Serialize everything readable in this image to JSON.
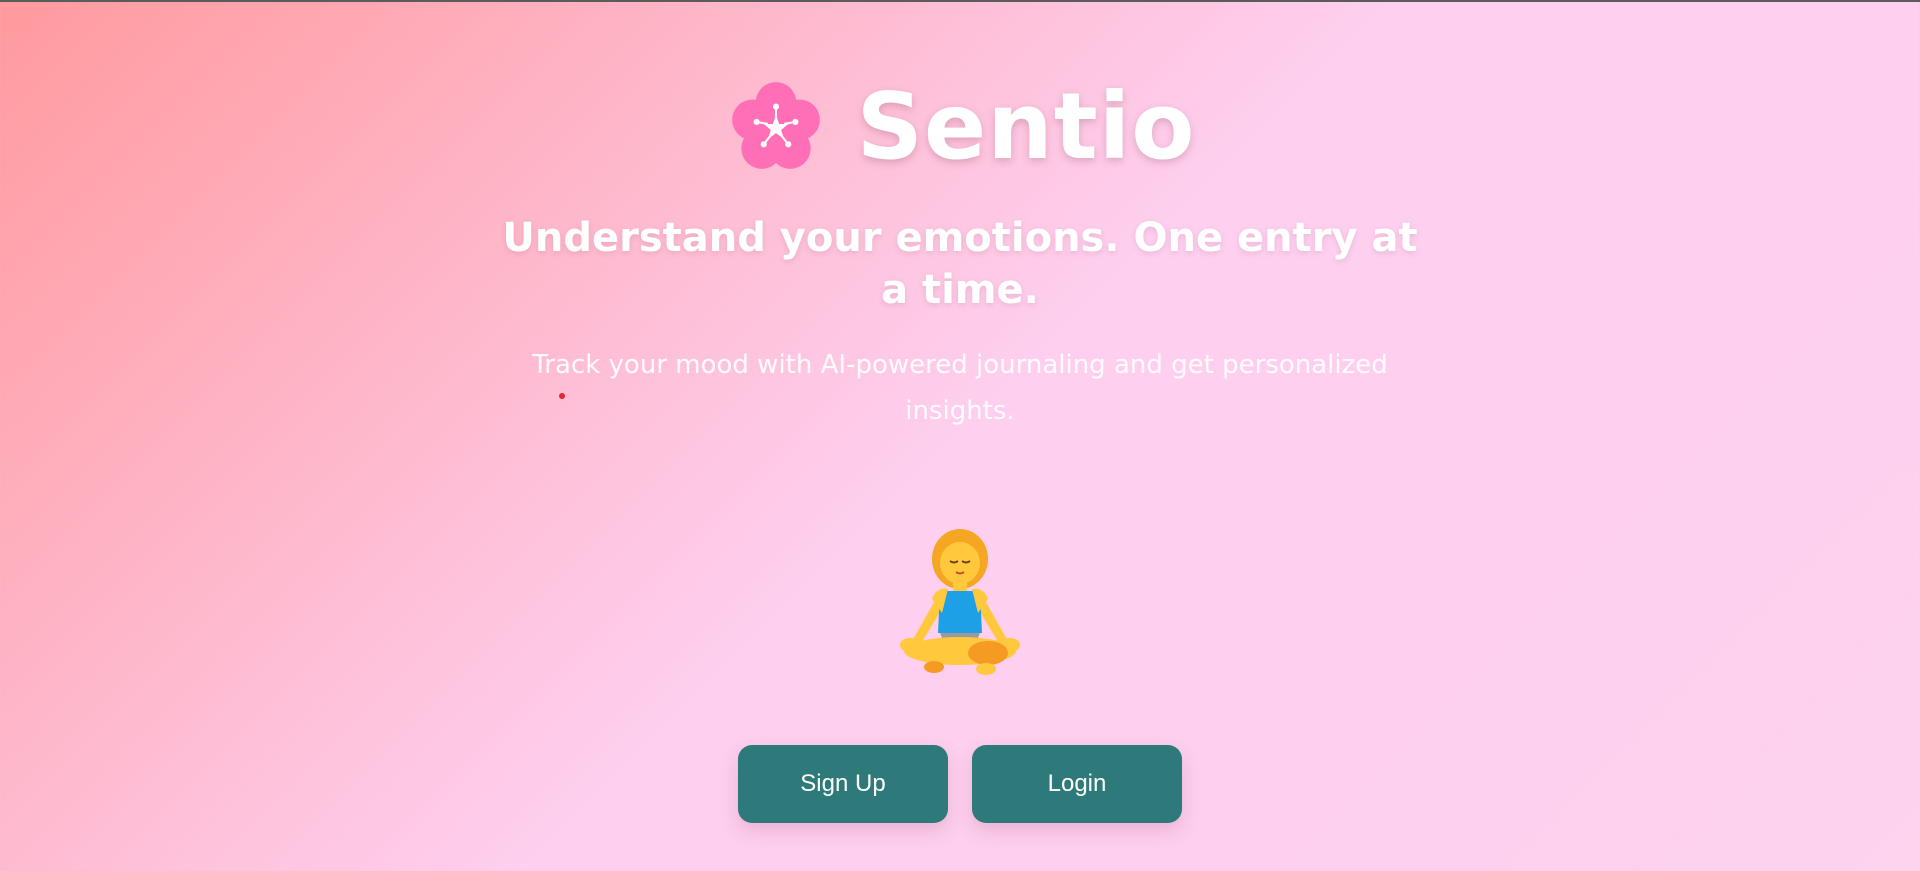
{
  "brand": {
    "name": "Sentio",
    "logo_icon": "cherry-blossom-icon",
    "logo_color": "#ff6fb8"
  },
  "hero": {
    "headline": "Understand your emotions. One entry at a time.",
    "subtext": "Track your mood with AI-powered journaling and get personalized insights.",
    "illustration_icon": "person-meditating-icon"
  },
  "actions": {
    "signup_label": "Sign Up",
    "login_label": "Login",
    "button_color": "#2e7a7a"
  },
  "colors": {
    "background_start": "#ff9a9e",
    "background_end": "#fecfef"
  }
}
